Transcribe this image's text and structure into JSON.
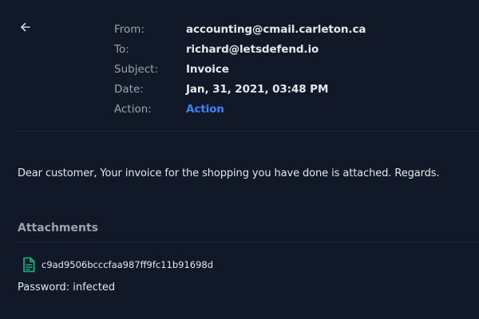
{
  "header": {
    "fields": [
      {
        "label": "From:",
        "value": "accounting@cmail.carleton.ca"
      },
      {
        "label": "To:",
        "value": "richard@letsdefend.io"
      },
      {
        "label": "Subject:",
        "value": "Invoice"
      },
      {
        "label": "Date:",
        "value": "Jan, 31, 2021, 03:48 PM"
      },
      {
        "label": "Action:",
        "value": "Action"
      }
    ]
  },
  "message": {
    "body": "Dear customer, Your invoice for the shopping you have done is attached. Regards."
  },
  "attachments": {
    "title": "Attachments",
    "items": [
      {
        "filename": "c9ad9506bcccfaa987ff9fc11b91698d",
        "icon": "file-document-icon"
      }
    ],
    "password": "Password: infected"
  },
  "icons": {
    "back": "arrow-left-icon"
  },
  "colors": {
    "background": "#111827",
    "label": "#9ca3af",
    "text": "#e5e7eb",
    "link": "#3b82f6",
    "attachment_icon": "#10b981",
    "divider": "#1f2937"
  }
}
